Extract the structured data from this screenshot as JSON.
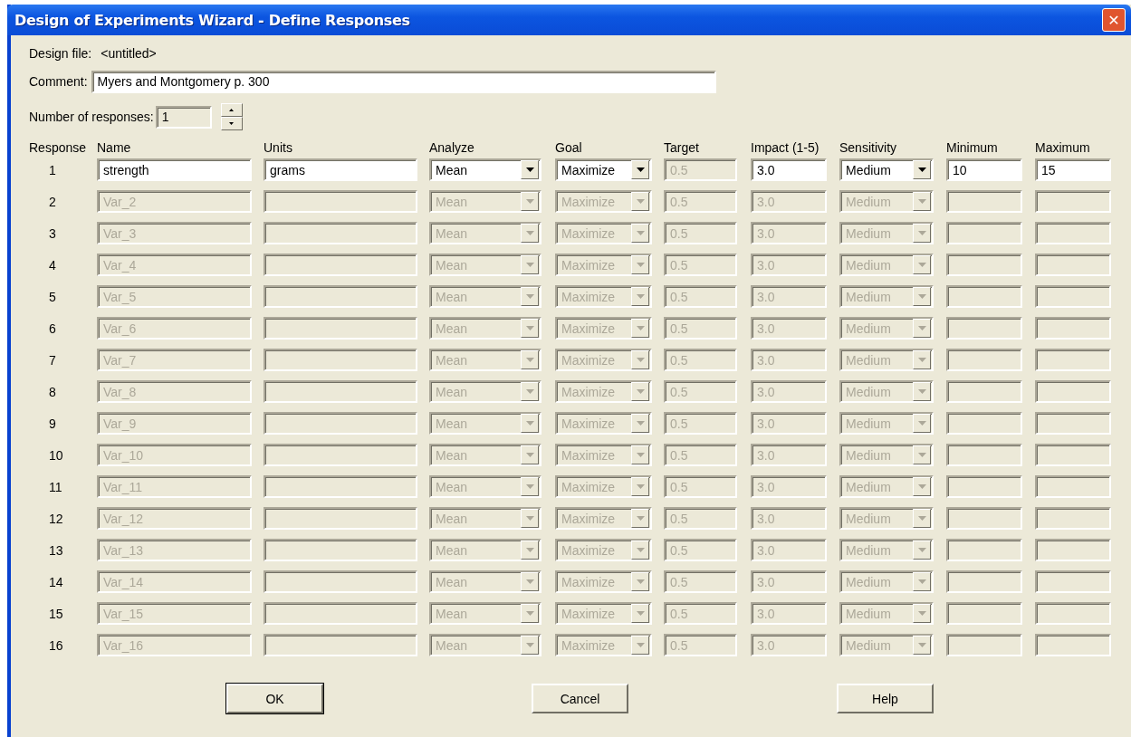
{
  "window": {
    "title": "Design of Experiments Wizard - Define Responses",
    "close": "✕"
  },
  "design_file": {
    "label": "Design file:",
    "value": "<untitled>"
  },
  "comment": {
    "label": "Comment:",
    "value": "Myers and Montgomery p. 300"
  },
  "responses_count": {
    "label": "Number of responses:",
    "value": "1"
  },
  "columns": [
    "Response",
    "Name",
    "Units",
    "Analyze",
    "Goal",
    "Target",
    "Impact (1-5)",
    "Sensitivity",
    "Minimum",
    "Maximum"
  ],
  "rows": [
    {
      "number": "1",
      "name": "strength",
      "units": "grams",
      "analyze": "Mean",
      "goal": "Maximize",
      "target": "0.5",
      "impact": "3.0",
      "sensitivity": "Medium",
      "minimum": "10",
      "maximum": "15",
      "disabled": false,
      "target_disabled": true
    },
    {
      "number": "2",
      "name": "Var_2",
      "analyze": "Mean",
      "goal": "Maximize",
      "target": "0.5",
      "impact": "3.0",
      "sensitivity": "Medium",
      "disabled": true,
      "target_disabled": true
    },
    {
      "number": "3",
      "name": "Var_3",
      "analyze": "Mean",
      "goal": "Maximize",
      "target": "0.5",
      "impact": "3.0",
      "sensitivity": "Medium",
      "disabled": true,
      "target_disabled": true
    },
    {
      "number": "4",
      "name": "Var_4",
      "analyze": "Mean",
      "goal": "Maximize",
      "target": "0.5",
      "impact": "3.0",
      "sensitivity": "Medium",
      "disabled": true,
      "target_disabled": true
    },
    {
      "number": "5",
      "name": "Var_5",
      "analyze": "Mean",
      "goal": "Maximize",
      "target": "0.5",
      "impact": "3.0",
      "sensitivity": "Medium",
      "disabled": true,
      "target_disabled": true
    },
    {
      "number": "6",
      "name": "Var_6",
      "analyze": "Mean",
      "goal": "Maximize",
      "target": "0.5",
      "impact": "3.0",
      "sensitivity": "Medium",
      "disabled": true,
      "target_disabled": true
    },
    {
      "number": "7",
      "name": "Var_7",
      "analyze": "Mean",
      "goal": "Maximize",
      "target": "0.5",
      "impact": "3.0",
      "sensitivity": "Medium",
      "disabled": true,
      "target_disabled": true
    },
    {
      "number": "8",
      "name": "Var_8",
      "analyze": "Mean",
      "goal": "Maximize",
      "target": "0.5",
      "impact": "3.0",
      "sensitivity": "Medium",
      "disabled": true,
      "target_disabled": true
    },
    {
      "number": "9",
      "name": "Var_9",
      "analyze": "Mean",
      "goal": "Maximize",
      "target": "0.5",
      "impact": "3.0",
      "sensitivity": "Medium",
      "disabled": true,
      "target_disabled": true
    },
    {
      "number": "10",
      "name": "Var_10",
      "analyze": "Mean",
      "goal": "Maximize",
      "target": "0.5",
      "impact": "3.0",
      "sensitivity": "Medium",
      "disabled": true,
      "target_disabled": true
    },
    {
      "number": "11",
      "name": "Var_11",
      "analyze": "Mean",
      "goal": "Maximize",
      "target": "0.5",
      "impact": "3.0",
      "sensitivity": "Medium",
      "disabled": true,
      "target_disabled": true
    },
    {
      "number": "12",
      "name": "Var_12",
      "analyze": "Mean",
      "goal": "Maximize",
      "target": "0.5",
      "impact": "3.0",
      "sensitivity": "Medium",
      "disabled": true,
      "target_disabled": true
    },
    {
      "number": "13",
      "name": "Var_13",
      "analyze": "Mean",
      "goal": "Maximize",
      "target": "0.5",
      "impact": "3.0",
      "sensitivity": "Medium",
      "disabled": true,
      "target_disabled": true
    },
    {
      "number": "14",
      "name": "Var_14",
      "analyze": "Mean",
      "goal": "Maximize",
      "target": "0.5",
      "impact": "3.0",
      "sensitivity": "Medium",
      "disabled": true,
      "target_disabled": true
    },
    {
      "number": "15",
      "name": "Var_15",
      "analyze": "Mean",
      "goal": "Maximize",
      "target": "0.5",
      "impact": "3.0",
      "sensitivity": "Medium",
      "disabled": true,
      "target_disabled": true
    },
    {
      "number": "16",
      "name": "Var_16",
      "analyze": "Mean",
      "goal": "Maximize",
      "target": "0.5",
      "impact": "3.0",
      "sensitivity": "Medium",
      "disabled": true,
      "target_disabled": true
    }
  ],
  "buttons": [
    {
      "label": "OK",
      "default": true
    },
    {
      "label": "Cancel",
      "default": false
    },
    {
      "label": "Help",
      "default": false
    }
  ]
}
